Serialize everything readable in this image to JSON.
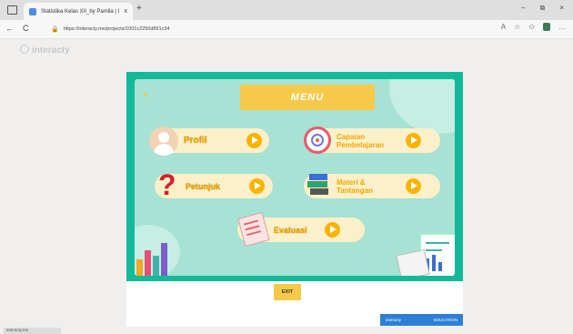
{
  "browser": {
    "tab_title": "Statistika Kelas XII_by Pamila | I",
    "tab_close": "x",
    "new_tab": "+",
    "url": "https://interacty.me/projects/1001c2250d891c34",
    "window_controls": [
      "–",
      "⧉",
      "×"
    ],
    "nav": {
      "back": "←",
      "reload": "C"
    },
    "right_icons": [
      "A",
      "☆",
      "✩",
      "…"
    ]
  },
  "site": {
    "brand": "interacty"
  },
  "menu": {
    "title": "MENU",
    "buttons": [
      {
        "label": "Profil",
        "icon": "person-icon"
      },
      {
        "label_line1": "Capaian",
        "label_line2": "Pembelajaran",
        "icon": "target-icon"
      },
      {
        "label": "Petunjuk",
        "icon": "question-icon"
      },
      {
        "label_line1": "Materi &",
        "label_line2": "Tantangan",
        "icon": "books-icon"
      },
      {
        "label": "Evaluasi",
        "icon": "checklist-icon"
      }
    ]
  },
  "exit_label": "EXIT",
  "badge": {
    "left": "interacty",
    "right": "EDUCATION"
  },
  "status_bar": "interacty.me",
  "colors": {
    "teal": "#14b99a",
    "panel": "#a7e2d4",
    "yellow": "#f7c948",
    "button_bg": "#fbf0c9",
    "badge": "#2d7fd6"
  }
}
